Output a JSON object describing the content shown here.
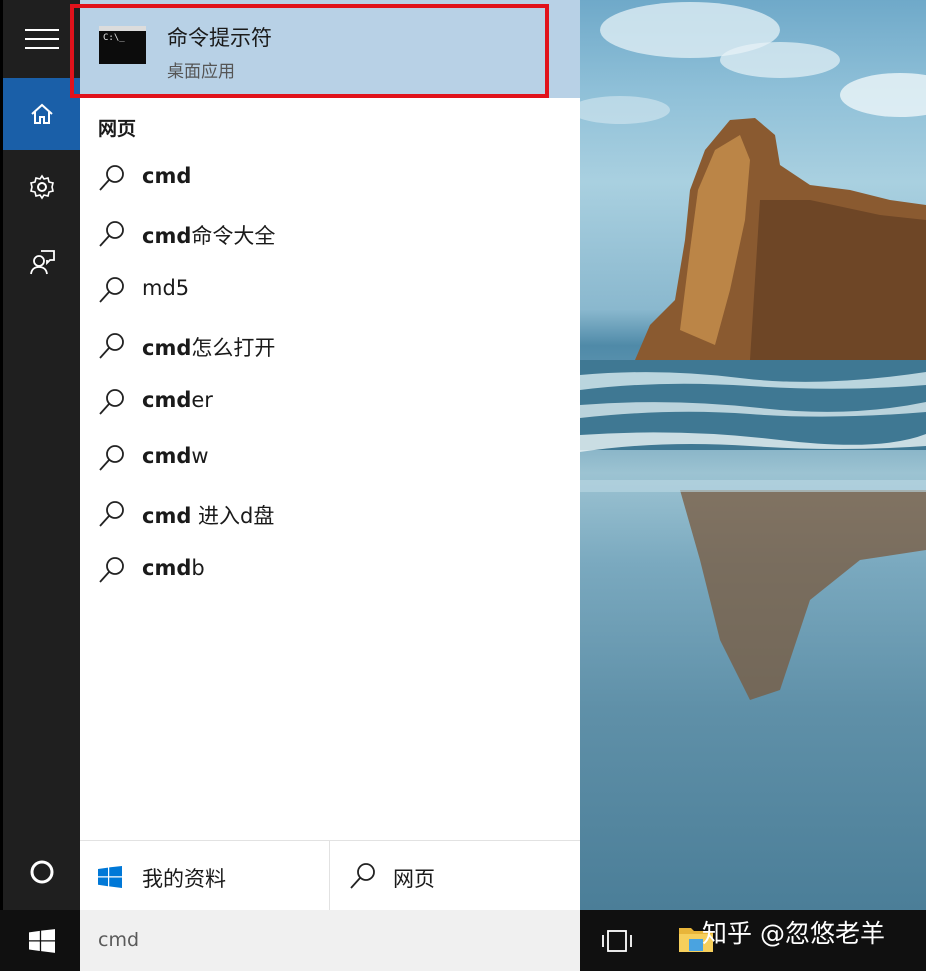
{
  "top_result": {
    "title": "命令提示符",
    "subtitle": "桌面应用",
    "icon_text": "C:\\_"
  },
  "section": {
    "label": "网页"
  },
  "suggestions": [
    {
      "bold": "cmd",
      "rest": ""
    },
    {
      "bold": "cmd",
      "rest": "命令大全"
    },
    {
      "bold": "",
      "rest": "md5"
    },
    {
      "bold": "cmd",
      "rest": "怎么打开"
    },
    {
      "bold": "cmd",
      "rest": "er"
    },
    {
      "bold": "cmd",
      "rest": "w"
    },
    {
      "bold": "cmd",
      "rest": " 进入d盘"
    },
    {
      "bold": "cmd",
      "rest": "b"
    }
  ],
  "bottom_tabs": {
    "my_stuff": "我的资料",
    "web": "网页"
  },
  "search": {
    "value": "cmd"
  },
  "watermark": "知乎 @忽悠老羊",
  "colors": {
    "highlight_border": "#e1121b",
    "top_result_bg": "#b8d1e6",
    "rail_bg": "#1f1f1f",
    "rail_active": "#1a5fa8",
    "windows_blue": "#0078d7"
  }
}
